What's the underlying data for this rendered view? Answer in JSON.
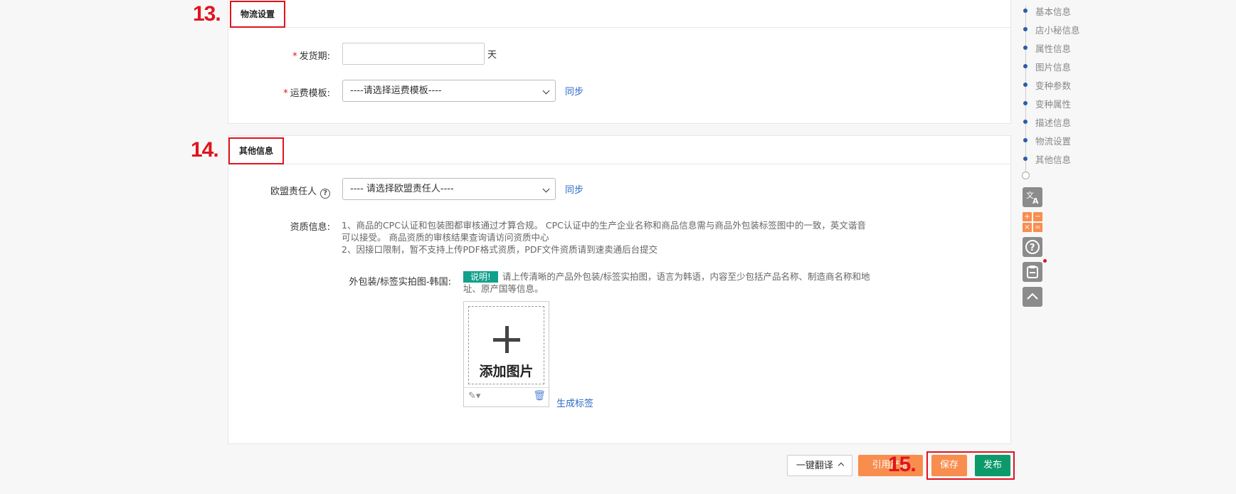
{
  "annotations": {
    "step13": "13.",
    "step14": "14.",
    "step15": "15."
  },
  "logistics": {
    "title": "物流设置",
    "ship_period_label": "发货期:",
    "ship_period_value": "",
    "ship_period_unit": "天",
    "freight_template_label": "运费模板:",
    "freight_template_selected": "----请选择运费模板----",
    "sync_label": "同步"
  },
  "other_info": {
    "title": "其他信息",
    "eu_rep_label": "欧盟责任人",
    "eu_rep_selected": "---- 请选择欧盟责任人----",
    "sync_label": "同步",
    "qualification_label": "资质信息:",
    "qualification_line1": "1、商品的CPC认证和包装图都审核通过才算合规。 CPC认证中的生产企业名称和商品信息需与商品外包装标签图中的一致，英文谐音",
    "qualification_line2": "可以接受。 商品资质的审核结果查询请访问资质中心",
    "qualification_line3": "2、因接口限制，暂不支持上传PDF格式资质，PDF文件资质请到速卖通后台提交",
    "package_label": "外包装/标签实拍图-韩国:",
    "note_badge": "说明!",
    "note_text_line1": "请上传清晰的产品外包装/标签实拍图，语言为韩语，内容至少包括产品名称、制造商名称和地",
    "note_text_line2": "址、原产国等信息。",
    "add_image_label": "添加图片",
    "generate_label": "生成标签"
  },
  "footer": {
    "translate_label": "一键翻译",
    "ref_product_label": "引用产品",
    "save_label": "保存",
    "publish_label": "发布"
  },
  "nav": {
    "items": [
      "基本信息",
      "店小秘信息",
      "属性信息",
      "图片信息",
      "变种参数",
      "变种属性",
      "描述信息",
      "物流设置",
      "其他信息"
    ]
  },
  "tools": {
    "translate_icon": "translate-icon",
    "calculator_icon": "calculator-icon",
    "help_icon": "help-icon",
    "clipboard_icon": "clipboard-icon",
    "top_icon": "back-to-top-icon"
  },
  "colors": {
    "annotation_red": "#e0141e",
    "link_blue": "#2d6bc7",
    "orange": "#f98d4e",
    "green": "#0c9a6b",
    "badge_teal": "#11a08b"
  }
}
